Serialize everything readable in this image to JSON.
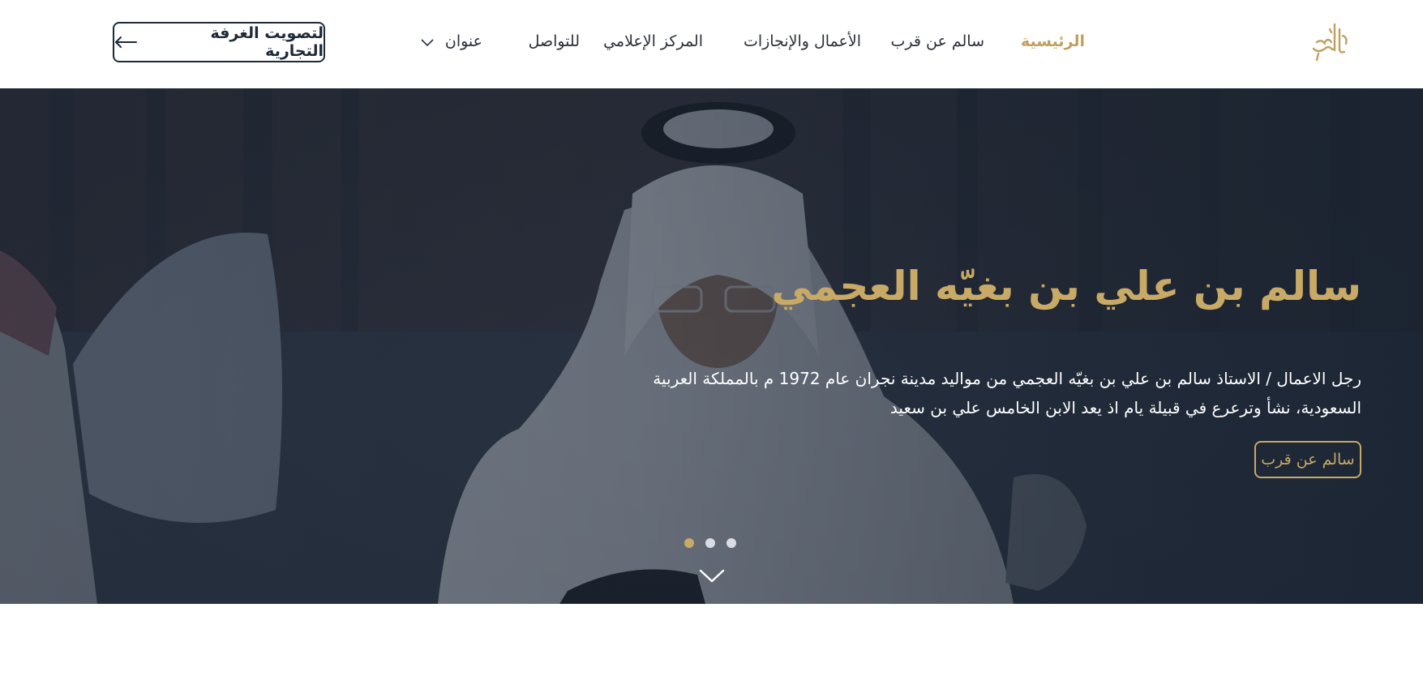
{
  "header": {
    "logo_text": "سالم",
    "nav": {
      "home": "الرئيسية",
      "about": "سالم عن قرب",
      "works": "الأعمال والإنجازات",
      "media": "المركز الإعلامي",
      "contact": "للتواصل",
      "title_menu": "عنوان"
    },
    "vote_button": "لتصويت الغرفة التجارية"
  },
  "hero": {
    "title": "سالم بن علي بن بغيّه العجمي",
    "description": "رجل الاعمال / الاستاذ سالم بن علي بن بغيّه العجمي من مواليد مدينة نجران عام 1972 م بالمملكة العربية السعودية، نشأ وترعرع في قبيلة يام اذ يعد الابن الخامس علي بن سعيد",
    "button": "سالم عن قرب",
    "slides": {
      "count": 3,
      "active": 1
    }
  },
  "icons": {
    "logo": "salem-calligraphy-logo",
    "vote_arrow": "arrow-left-icon",
    "nav_dropdown": "chevron-down-icon",
    "scroll": "chevron-down-icon"
  },
  "colors": {
    "accent_gold": "#c8a966",
    "nav_active": "#c0a060",
    "dark_navy": "#1e2a38",
    "hero_overlay": "#16202e"
  }
}
